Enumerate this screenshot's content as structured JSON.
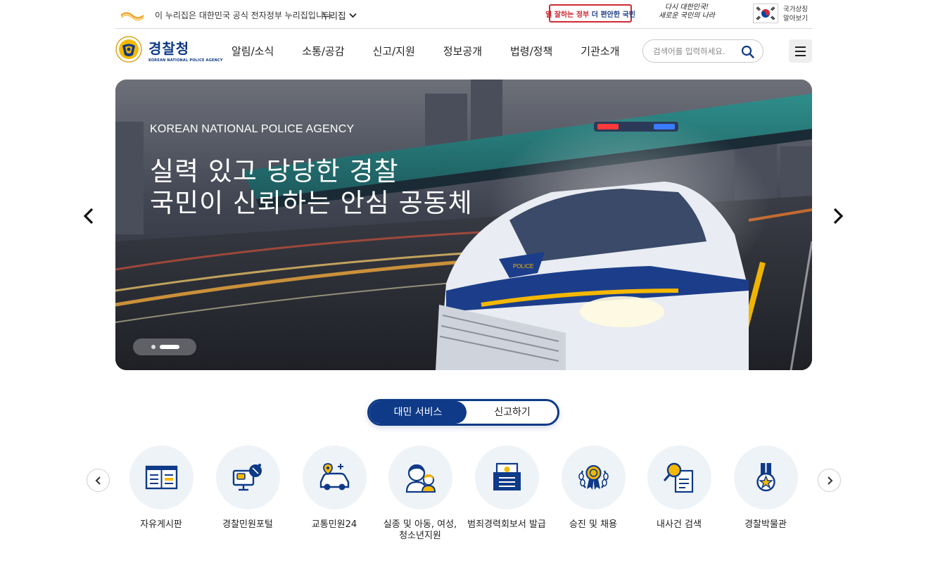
{
  "gov_bar": {
    "notice": "이 누리집은 대한민국 공식 전자정부 누리집입니다.",
    "dropdown_label": "누리집",
    "slogan_left": "일 잘하는 정부",
    "slogan_mid": "더",
    "slogan_right": "편안한 국민",
    "slogan2_line1": "다시 대한민국!",
    "slogan2_line2": "새로운 국민의 나라",
    "national_symbol_line1": "국가상징",
    "national_symbol_line2": "알아보기"
  },
  "header": {
    "brand_ko": "경찰청",
    "brand_en": "KOREAN NATIONAL POLICE AGENCY",
    "nav": [
      "알림/소식",
      "소통/공감",
      "신고/지원",
      "정보공개",
      "법령/정책",
      "기관소개"
    ],
    "search_placeholder": "검색어를 입력하세요.",
    "search_value": ""
  },
  "hero": {
    "subtitle_en": "KOREAN NATIONAL POLICE AGENCY",
    "line1": "실력 있고 당당한 경찰",
    "line2": "국민이 신뢰하는 안심 공동체",
    "car_emblem_text": "POLICE"
  },
  "service_tabs": {
    "active": "대민 서비스",
    "inactive": "신고하기"
  },
  "services": [
    {
      "label": "자유게시판",
      "icon": "bulletin-board-icon"
    },
    {
      "label": "경찰민원포털",
      "icon": "civil-portal-icon"
    },
    {
      "label": "교통민원24",
      "icon": "traffic-car-icon"
    },
    {
      "label": "실종 및 아동, 여성, 청소년지원",
      "icon": "family-icon"
    },
    {
      "label": "범죄경력회보서 발급",
      "icon": "certificate-icon"
    },
    {
      "label": "승진 및 채용",
      "icon": "medal-wreath-icon"
    },
    {
      "label": "내사건 검색",
      "icon": "document-search-icon"
    },
    {
      "label": "경찰박물관",
      "icon": "museum-medal-icon"
    }
  ],
  "colors": {
    "brand_navy": "#0e3a88",
    "accent_yellow": "#f5b800",
    "icon_bg": "#eef3f8",
    "slogan_red": "#cf2b33"
  }
}
